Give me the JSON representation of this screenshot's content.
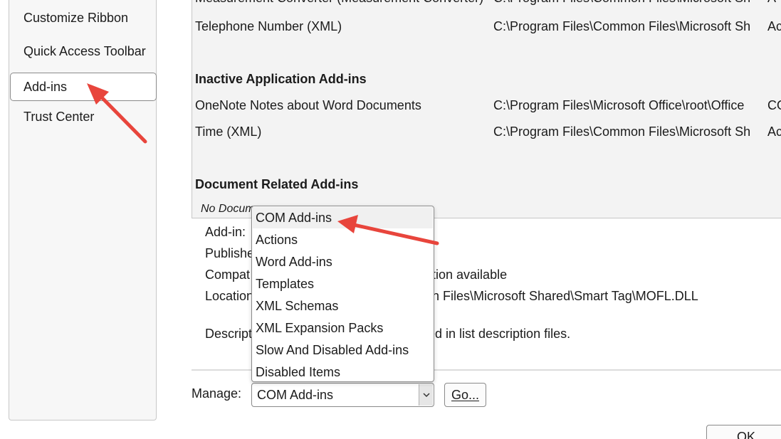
{
  "sidebar": {
    "items": [
      {
        "label": "Customize Ribbon"
      },
      {
        "label": "Quick Access Toolbar"
      },
      {
        "label": "Add-ins"
      },
      {
        "label": "Trust Center"
      }
    ],
    "selected": "Add-ins"
  },
  "addins_list": {
    "partial_row": {
      "name": "Measurement Converter (Measurement Converter)",
      "location": "C:\\Program Files\\Common Files\\Microsoft Sh",
      "type": "A"
    },
    "active_rows": [
      {
        "name": "Telephone Number (XML)",
        "location": "C:\\Program Files\\Common Files\\Microsoft Sh",
        "type": "Ac"
      }
    ],
    "inactive_section": {
      "title": "Inactive Application Add-ins",
      "rows": [
        {
          "name": "OneNote Notes about Word Documents",
          "location": "C:\\Program Files\\Microsoft Office\\root\\Office",
          "type": "CO"
        },
        {
          "name": "Time (XML)",
          "location": "C:\\Program Files\\Common Files\\Microsoft Sh",
          "type": "Ac"
        }
      ]
    },
    "document_section": {
      "title": "Document Related Add-ins",
      "note": "No Docum"
    }
  },
  "details": {
    "addin_label": "Add-in:",
    "publisher_label": "Publishe",
    "compat_label": "Compat",
    "compat_value": "ation available",
    "location_label": "Location",
    "location_value": "on Files\\Microsoft Shared\\Smart Tag\\MOFL.DLL",
    "description_label": "Descript",
    "description_value": "ied in list description files."
  },
  "manage": {
    "label": "Manage:",
    "selected_value": "COM Add-ins",
    "go_label": "Go...",
    "options": [
      "COM Add-ins",
      "Actions",
      "Word Add-ins",
      "Templates",
      "XML Schemas",
      "XML Expansion Packs",
      "Slow And Disabled Add-ins",
      "Disabled Items"
    ]
  },
  "footer": {
    "ok_label": "OK"
  },
  "icons": {
    "dropdown_chevron": "chevron-down-icon"
  },
  "colors": {
    "annotation_arrow": "#e8453c",
    "list_background": "#f3f3f3",
    "sidebar_background": "#f7f7f7"
  }
}
